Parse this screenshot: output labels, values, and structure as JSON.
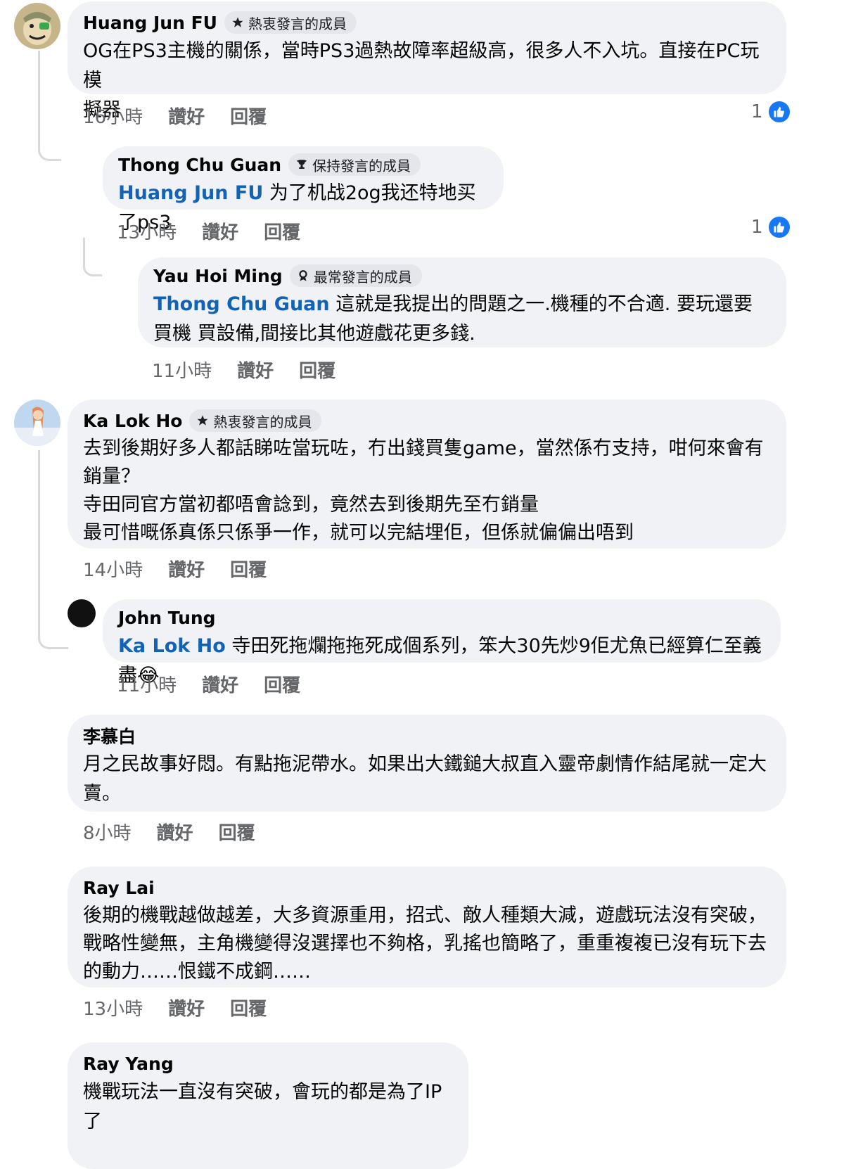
{
  "comments": [
    {
      "author": "Huang Jun FU",
      "badge": "熱衷發言的成員",
      "text": "OG在PS3主機的關係，當時PS3過熱故障率超級高，很多人不入坑。直接在PC玩模\n擬器",
      "time": "16小時",
      "like": "讚好",
      "reply": "回覆",
      "likes": "1"
    },
    {
      "author": "Thong Chu Guan",
      "badge": "保持發言的成員",
      "mention": "Huang Jun FU",
      "text": " 为了机战2og我还特地买了ps3",
      "time": "13小時",
      "like": "讚好",
      "reply": "回覆",
      "likes": "1"
    },
    {
      "author": "Yau Hoi Ming",
      "badge": "最常發言的成員",
      "mention": "Thong Chu Guan",
      "text": " 這就是我提出的問題之一.機種的不合適. 要玩還要買機 買設備,間接比其他遊戲花更多錢.",
      "time": "11小時",
      "like": "讚好",
      "reply": "回覆"
    },
    {
      "author": "Ka Lok Ho",
      "badge": "熱衷發言的成員",
      "text": "去到後期好多人都話睇咗當玩咗，冇出錢買隻game，當然係冇支持，咁何來會有銷量？\n寺田同官方￼當初都唔會諗到，竟然去到後期先至冇銷量\n￼最可惜嘅係真係只係爭一作，就可以完結埋佢，但係就偏偏出唔到￼",
      "time": "14小時",
      "like": "讚好",
      "reply": "回覆"
    },
    {
      "author": "John Tung",
      "mention": "Ka Lok Ho",
      "text": " 寺田死拖爛拖拖死成個系列，笨大30先炒9佢尤魚已經算仁至義盡😂",
      "time": "11小時",
      "like": "讚好",
      "reply": "回覆"
    },
    {
      "author": "李慕白",
      "text": "月之民故事好悶。有點拖泥帶水。如果出大鐵鎚大叔直入靈帝劇情作結尾就一定大賣。",
      "time": "8小時",
      "like": "讚好",
      "reply": "回覆"
    },
    {
      "author": "Ray Lai",
      "text": "後期的機戰越做越差，大多￼￼資源￼重用，招式、敵人種類大減，遊戲玩法沒有突破，戰略性變無，主角機變得沒選擇也不夠格，乳搖也￼簡略了，重重複複￼已沒有玩下去的動力……恨鐵不成鋼……",
      "time": "13小時",
      "like": "讚好",
      "reply": "回覆"
    },
    {
      "author": "Ray Yang",
      "text": "機戰玩法一直沒有突破，會玩的都是為了IP了"
    }
  ],
  "icons": {
    "badge_fan": "star-icon",
    "badge_keeper": "trophy-icon",
    "badge_top": "top-contributor-icon",
    "like_reaction": "thumbs-up-icon"
  },
  "colors": {
    "mention": "#1263b5",
    "bubble": "#f0f2f5",
    "like": "#1877f2"
  }
}
